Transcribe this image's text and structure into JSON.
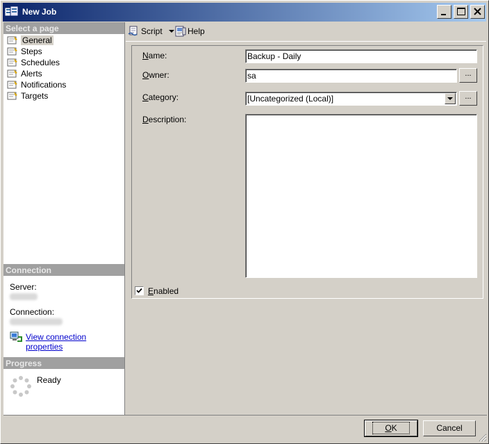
{
  "window": {
    "title": "New Job",
    "icon": "job-window-icon"
  },
  "sidebar": {
    "select_page_header": "Select a page",
    "pages": [
      {
        "label": "General",
        "selected": true,
        "icon": "page-icon"
      },
      {
        "label": "Steps",
        "icon": "page-icon"
      },
      {
        "label": "Schedules",
        "icon": "page-icon"
      },
      {
        "label": "Alerts",
        "icon": "page-icon"
      },
      {
        "label": "Notifications",
        "icon": "page-icon"
      },
      {
        "label": "Targets",
        "icon": "page-icon"
      }
    ],
    "connection": {
      "header": "Connection",
      "server_label": "Server:",
      "connection_label": "Connection:",
      "view_link": "View connection properties"
    },
    "progress": {
      "header": "Progress",
      "status": "Ready"
    }
  },
  "toolbar": {
    "script_label": "Script",
    "help_label": "Help"
  },
  "form": {
    "name_label": "Name:",
    "name_value": "Backup - Daily",
    "owner_label": "Owner:",
    "owner_value": "sa",
    "category_label": "Category:",
    "category_value": "[Uncategorized (Local)]",
    "description_label": "Description:",
    "description_value": "",
    "enabled_label": "Enabled",
    "enabled_checked": true,
    "ellipsis": "..."
  },
  "footer": {
    "ok_label": "OK",
    "cancel_label": "Cancel"
  },
  "colors": {
    "title_start": "#0a246a",
    "title_end": "#a6caf0",
    "face": "#d4d0c8",
    "section_header": "#a0a0a0",
    "link": "#0000cc"
  }
}
